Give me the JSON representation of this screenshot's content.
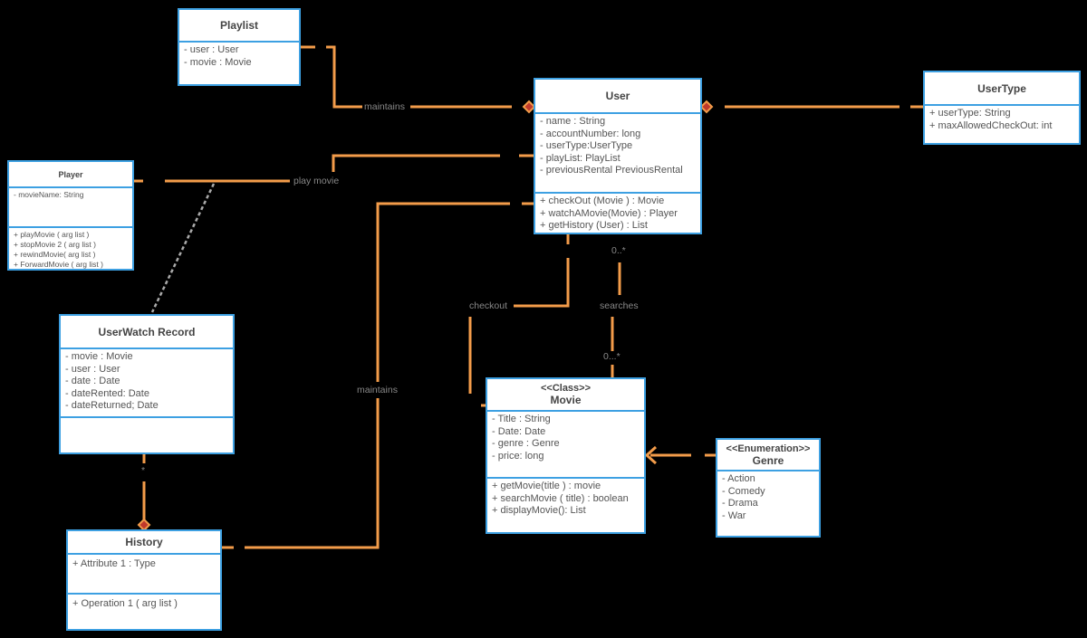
{
  "colors": {
    "background": "#000000",
    "box_border": "#3da0e2",
    "connector": "#f39c4a",
    "label_text": "#888888",
    "dependency": "#aaaaaa"
  },
  "classes": {
    "playlist": {
      "name": "Playlist",
      "attributes": [
        "- user : User",
        "- movie : Movie"
      ],
      "operations": []
    },
    "user": {
      "name": "User",
      "attributes": [
        "- name : String",
        "- accountNumber: long",
        "-  userType:UserType",
        "- playList: PlayList",
        "- previousRental PreviousRental"
      ],
      "operations": [
        "+ checkOut (Movie ) : Movie",
        "+ watchAMovie(Movie) : Player",
        "+ getHistory (User) : List"
      ]
    },
    "usertype": {
      "name": "UserType",
      "attributes": [
        "+ userType: String",
        "+ maxAllowedCheckOut: int"
      ],
      "operations": []
    },
    "player": {
      "name": "Player",
      "attributes": [
        "- movieName: String"
      ],
      "operations": [
        "+ playMovie ( arg list )",
        "+ stopMovie 2 ( arg list )",
        "+  rewindMovie( arg list )",
        "+ ForwardMovie ( arg list )"
      ]
    },
    "userwatch": {
      "name": "UserWatch Record",
      "attributes": [
        "- movie : Movie",
        "- user : User",
        "- date : Date",
        "- dateRented: Date",
        "- dateReturned; Date"
      ],
      "operations": []
    },
    "history": {
      "name": "History",
      "attributes": [
        "+ Attribute 1 : Type"
      ],
      "operations": [
        "+ Operation 1 ( arg list )"
      ]
    },
    "movie": {
      "stereotype": "<<Class>>",
      "name": "Movie",
      "attributes": [
        "- Title : String",
        "- Date: Date",
        "- genre : Genre",
        "- price: long"
      ],
      "operations": [
        "+ getMovie(title ) : movie",
        "+ searchMovie ( title) : boolean",
        "+ displayMovie(): List"
      ]
    },
    "genre": {
      "stereotype": "<<Enumeration>>",
      "name": "Genre",
      "attributes": [
        "- Action",
        "- Comedy",
        "- Drama",
        "- War"
      ],
      "operations": []
    }
  },
  "labels": {
    "maintains_top": "maintains",
    "play_movie": "play movie",
    "checkout": "checkout",
    "searches": "searches",
    "maintains_left": "maintains",
    "mult_user_search": "0..*",
    "mult_movie_search": "0...*",
    "mult_userwatch_history": "*"
  }
}
